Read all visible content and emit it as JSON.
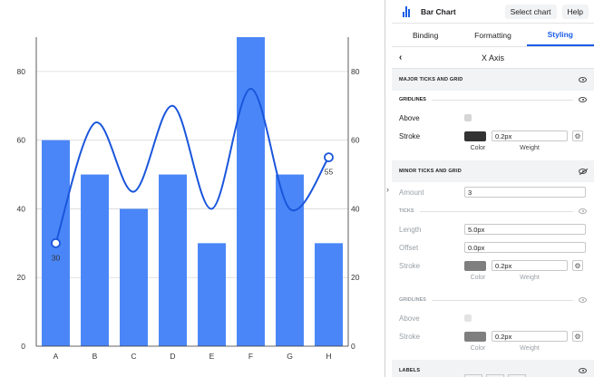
{
  "chart_data": {
    "type": "bar",
    "categories": [
      "A",
      "B",
      "C",
      "D",
      "E",
      "F",
      "G",
      "H"
    ],
    "series": [
      {
        "type": "bar",
        "values": [
          60,
          50,
          40,
          50,
          30,
          90,
          50,
          30
        ],
        "color": "#4a86f7"
      },
      {
        "type": "line",
        "values": [
          30,
          65,
          45,
          70,
          40,
          75,
          40,
          55
        ],
        "color": "#1a56db"
      }
    ],
    "ylim": [
      0,
      90
    ],
    "yticks": [
      0,
      20,
      40,
      60,
      80
    ],
    "point_labels": [
      {
        "category": "A",
        "text": "30"
      },
      {
        "category": "H",
        "text": "55"
      }
    ],
    "grid": true,
    "right_axis": true
  },
  "panel": {
    "title": "Bar Chart",
    "select_chart": "Select chart",
    "help": "Help",
    "tabs": [
      "Binding",
      "Formatting",
      "Styling"
    ],
    "active_tab": "Styling",
    "nav_title": "X Axis",
    "major_ticks": "MAJOR TICKS AND GRID",
    "gridlines": "GRIDLINES",
    "above": "Above",
    "stroke": "Stroke",
    "color_cap": "Color",
    "weight_cap": "Weight",
    "major_stroke_color": "#333333",
    "major_weight": "0.2px",
    "minor_ticks": "MINOR TICKS AND GRID",
    "amount_label": "Amount",
    "amount_value": "3",
    "ticks": "TICKS",
    "length_label": "Length",
    "length_value": "5.0px",
    "offset_label": "Offset",
    "offset_value": "0.0px",
    "minor_stroke_color": "#7f7f7f",
    "minor_weight": "0.2px",
    "minor_gridlines": "GRIDLINES",
    "minor_grid_weight": "0.2px",
    "labels": "LABELS"
  }
}
